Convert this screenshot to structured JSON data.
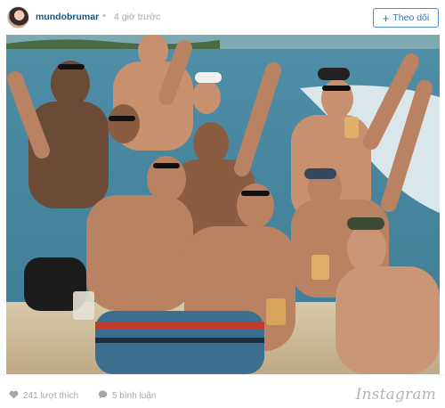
{
  "post": {
    "username": "mundobrumar",
    "separator": "•",
    "time_ago": "4 giờ trước",
    "follow_label": "Theo dõi",
    "follow_icon": "plus-icon"
  },
  "photo": {
    "description_icon": "photo"
  },
  "footer": {
    "likes_label": "241 lượt thích",
    "comments_label": "5 bình luận",
    "brand": "Instagram"
  },
  "colors": {
    "username": "#125688",
    "follow_border": "#4e8cc9",
    "muted": "#a5a7aa"
  }
}
